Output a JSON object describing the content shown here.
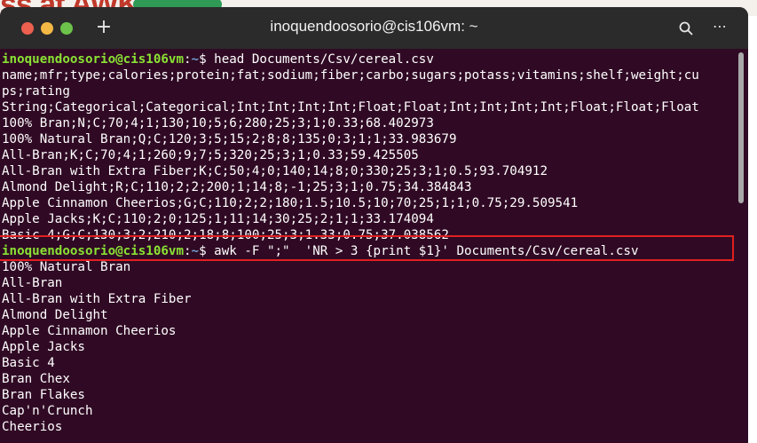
{
  "background_text": "ss at AWK",
  "window": {
    "title": "inoquendoosorio@cis106vm: ~",
    "new_tab_label": "+",
    "menu_label": "⋯"
  },
  "prompt": {
    "user_host": "inoquendoosorio@cis106vm",
    "separator": ":",
    "path": "~",
    "symbol": "$"
  },
  "commands": [
    " head Documents/Csv/cereal.csv",
    " awk -F \";\"  'NR > 3 {print $1}' Documents/Csv/cereal.csv"
  ],
  "head_output": [
    "name;mfr;type;calories;protein;fat;sodium;fiber;carbo;sugars;potass;vitamins;shelf;weight;cu",
    "ps;rating",
    "String;Categorical;Categorical;Int;Int;Int;Int;Float;Float;Int;Int;Int;Int;Float;Float;Float",
    "100% Bran;N;C;70;4;1;130;10;5;6;280;25;3;1;0.33;68.402973",
    "100% Natural Bran;Q;C;120;3;5;15;2;8;8;135;0;3;1;1;33.983679",
    "All-Bran;K;C;70;4;1;260;9;7;5;320;25;3;1;0.33;59.425505",
    "All-Bran with Extra Fiber;K;C;50;4;0;140;14;8;0;330;25;3;1;0.5;93.704912",
    "Almond Delight;R;C;110;2;2;200;1;14;8;-1;25;3;1;0.75;34.384843",
    "Apple Cinnamon Cheerios;G;C;110;2;2;180;1.5;10.5;10;70;25;1;1;0.75;29.509541",
    "Apple Jacks;K;C;110;2;0;125;1;11;14;30;25;2;1;1;33.174094",
    "Basic 4;G;C;130;3;2;210;2;18;8;100;25;3;1.33;0.75;37.038562"
  ],
  "awk_output": [
    "100% Natural Bran",
    "All-Bran",
    "All-Bran with Extra Fiber",
    "Almond Delight",
    "Apple Cinnamon Cheerios",
    "Apple Jacks",
    "Basic 4",
    "Bran Chex",
    "Bran Flakes",
    "Cap'n'Crunch",
    "Cheerios"
  ],
  "colors": {
    "terminal_bg": "#300a24",
    "titlebar_bg": "#2b2b2b",
    "prompt_user": "#8ae234",
    "prompt_path": "#729fcf",
    "highlight_border": "#e02020"
  }
}
